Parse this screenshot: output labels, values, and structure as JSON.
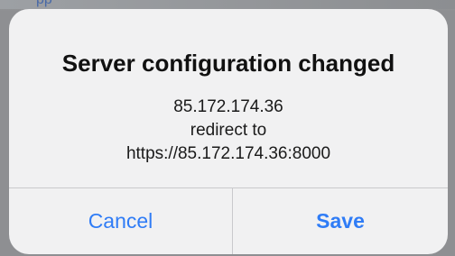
{
  "background": {
    "partial_text": "pp"
  },
  "alert": {
    "title": "Server configuration changed",
    "message_lines": [
      "85.172.174.36",
      "redirect to",
      "https://85.172.174.36:8000"
    ],
    "buttons": {
      "cancel_label": "Cancel",
      "save_label": "Save"
    }
  },
  "colors": {
    "accent": "#2f7cf6",
    "alert_background": "#f1f1f2",
    "backdrop": "#8e8f92",
    "divider": "#c9c9cc"
  }
}
